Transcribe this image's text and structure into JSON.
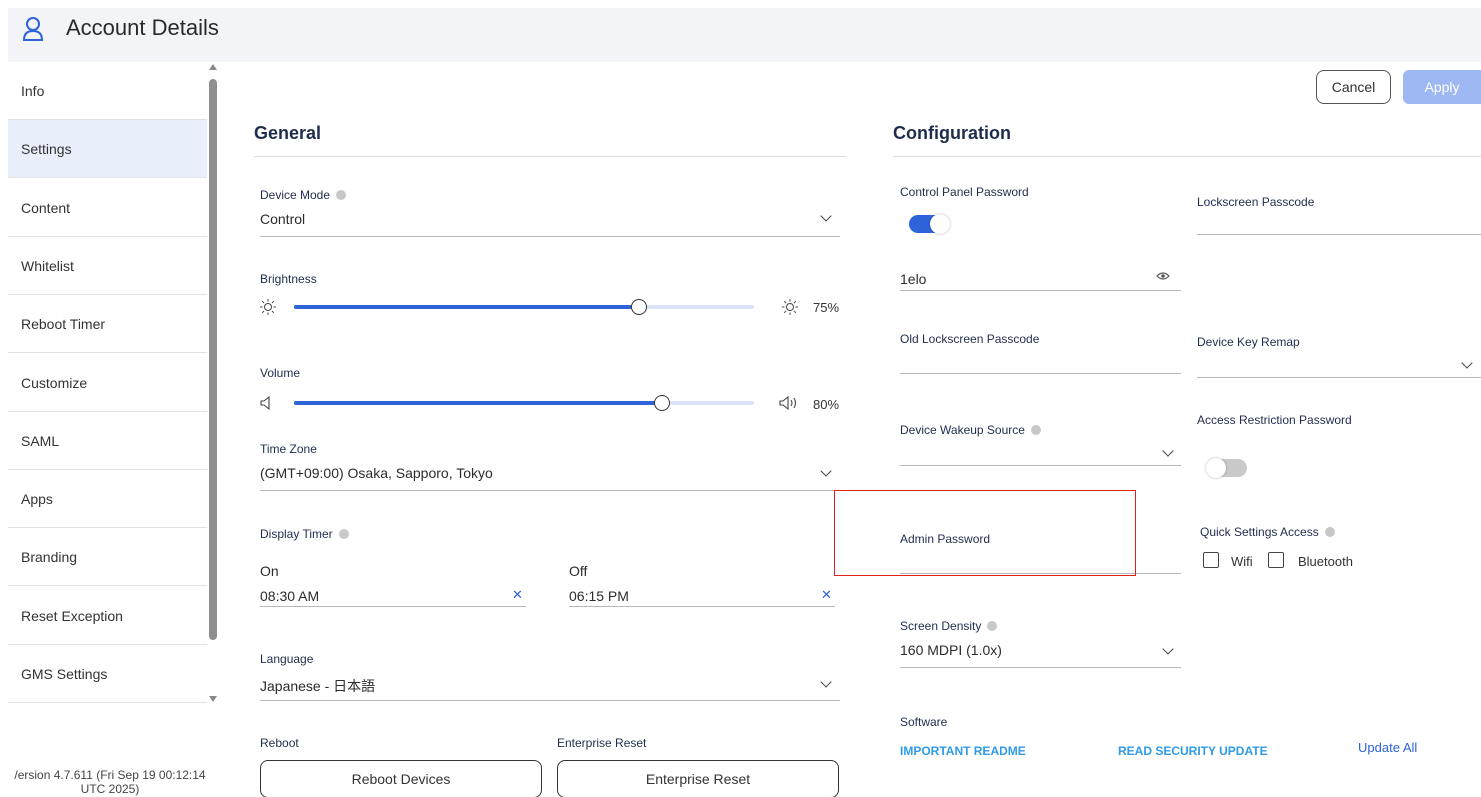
{
  "header": {
    "title": "Account Details",
    "icon": "user-icon"
  },
  "sidebar": {
    "items": [
      {
        "label": "Info"
      },
      {
        "label": "Settings"
      },
      {
        "label": "Content"
      },
      {
        "label": "Whitelist"
      },
      {
        "label": "Reboot Timer"
      },
      {
        "label": "Customize"
      },
      {
        "label": "SAML"
      },
      {
        "label": "Apps"
      },
      {
        "label": "Branding"
      },
      {
        "label": "Reset Exception"
      },
      {
        "label": "GMS Settings"
      }
    ],
    "active": "Settings"
  },
  "version": {
    "line1": "/ersion 4.7.611 (Fri Sep 19 00:12:14",
    "line2": "UTC 2025)"
  },
  "actions": {
    "cancel": "Cancel",
    "apply": "Apply"
  },
  "general": {
    "title": "General",
    "device_mode": {
      "label": "Device Mode",
      "value": "Control"
    },
    "brightness": {
      "label": "Brightness",
      "value_label": "75%",
      "level": 0.75
    },
    "volume": {
      "label": "Volume",
      "value_label": "80%",
      "level": 0.8
    },
    "time_zone": {
      "label": "Time Zone",
      "value": "(GMT+09:00) Osaka, Sapporo, Tokyo"
    },
    "display_timer": {
      "label": "Display Timer",
      "on_label": "On",
      "on_value": "08:30 AM",
      "off_label": "Off",
      "off_value": "06:15 PM"
    },
    "language": {
      "label": "Language",
      "value": "Japanese - 日本語"
    },
    "reboot": {
      "label": "Reboot",
      "button": "Reboot Devices"
    },
    "enterprise_reset": {
      "label": "Enterprise Reset",
      "button": "Enterprise Reset"
    }
  },
  "configuration": {
    "title": "Configuration",
    "control_panel_password": {
      "label": "Control Panel Password",
      "enabled": true,
      "value": "1elo"
    },
    "lockscreen_passcode": {
      "label": "Lockscreen Passcode",
      "value": ""
    },
    "old_lockscreen_passcode": {
      "label": "Old Lockscreen Passcode",
      "value": ""
    },
    "device_key_remap": {
      "label": "Device Key Remap",
      "value": ""
    },
    "device_wakeup_source": {
      "label": "Device Wakeup Source",
      "value": ""
    },
    "access_restriction_password": {
      "label": "Access Restriction Password",
      "enabled": false
    },
    "admin_password": {
      "label": "Admin Password",
      "value": ""
    },
    "quick_settings_access": {
      "label": "Quick Settings Access",
      "wifi": "Wifi",
      "bluetooth": "Bluetooth"
    },
    "screen_density": {
      "label": "Screen Density",
      "value": "160 MDPI (1.0x)"
    },
    "software": {
      "label": "Software",
      "readme": "IMPORTANT README",
      "security_update": "READ SECURITY UPDATE",
      "update_all": "Update All"
    }
  },
  "colors": {
    "accent": "#2e63d9",
    "highlight_box": "#e0201a",
    "link": "#2e9be6"
  }
}
